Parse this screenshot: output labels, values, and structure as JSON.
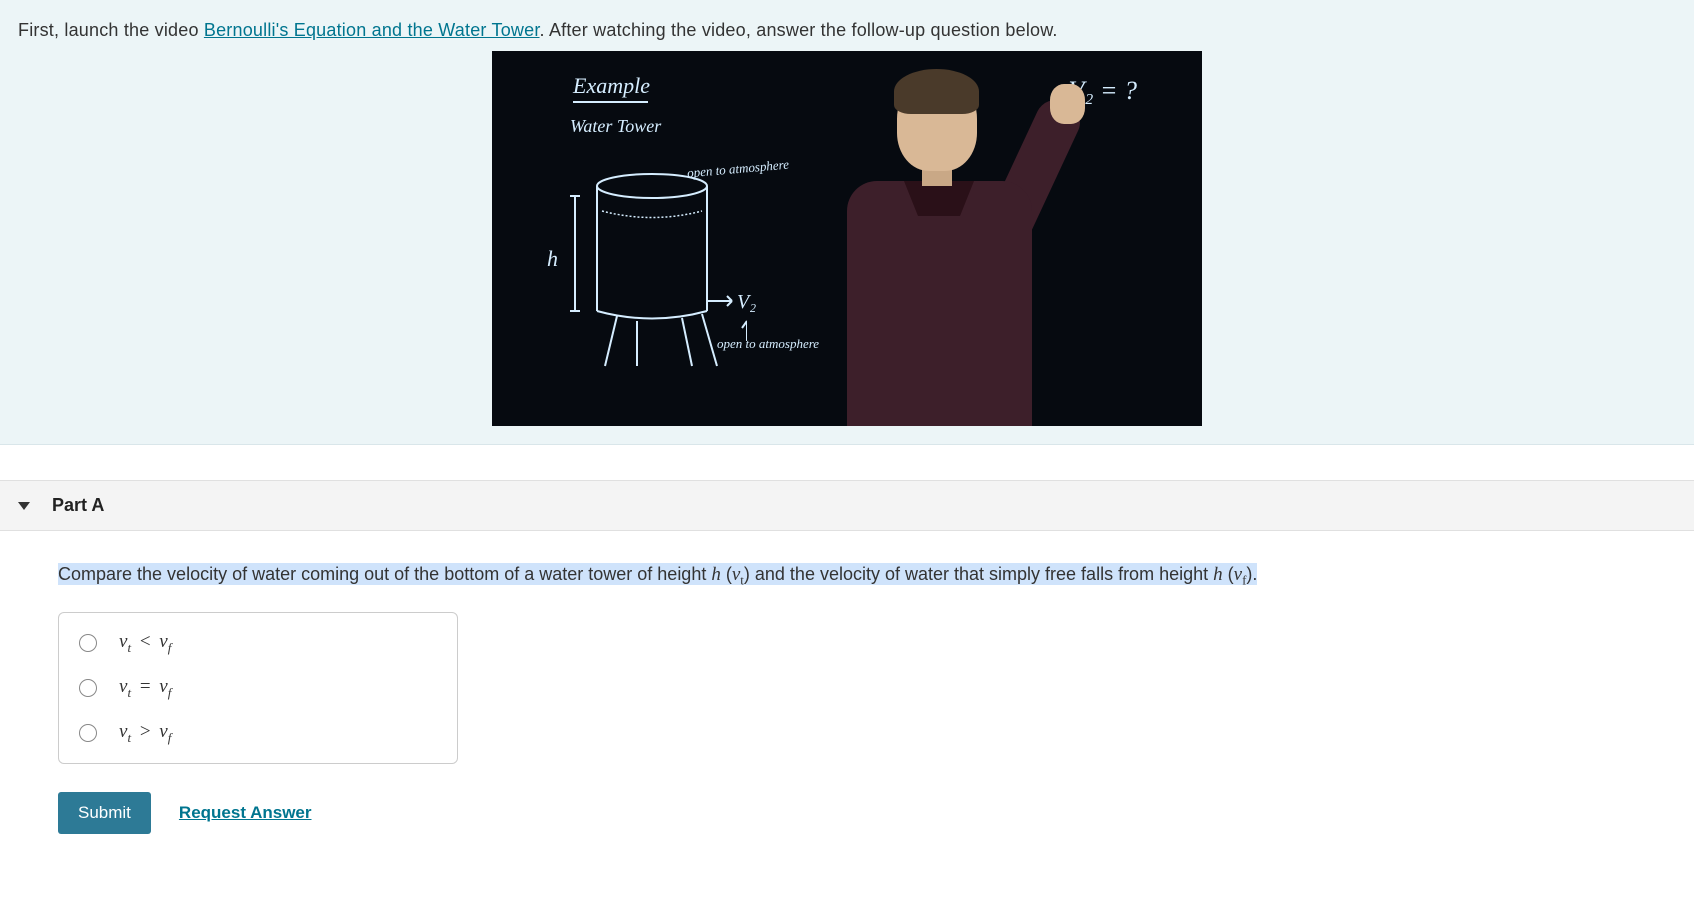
{
  "intro": {
    "prefix": "First, launch the video ",
    "link_text": "Bernoulli's Equation and the Water Tower",
    "suffix": ". After watching the video, answer the follow-up question below."
  },
  "video_board": {
    "title": "Example",
    "subtitle": "Water Tower",
    "open_top": "open to atmosphere",
    "open_bottom": "open to atmosphere",
    "h_label": "h",
    "v2_label": "V₂",
    "v2_question": "V₂ = ?"
  },
  "part": {
    "label": "Part A"
  },
  "question": {
    "seg1": "Compare the velocity of water coming out of the bottom of a water tower of height ",
    "h1": "h",
    "seg2": " (",
    "vt_var": "v",
    "vt_sub": "t",
    "seg3": ") and the velocity of water that simply free falls from height ",
    "h2": "h",
    "seg4": " (",
    "vf_var": "v",
    "vf_sub": "f",
    "seg5": ")."
  },
  "options": [
    {
      "lhs_v": "v",
      "lhs_s": "t",
      "op": "<",
      "rhs_v": "v",
      "rhs_s": "f"
    },
    {
      "lhs_v": "v",
      "lhs_s": "t",
      "op": "=",
      "rhs_v": "v",
      "rhs_s": "f"
    },
    {
      "lhs_v": "v",
      "lhs_s": "t",
      "op": ">",
      "rhs_v": "v",
      "rhs_s": "f"
    }
  ],
  "actions": {
    "submit": "Submit",
    "request": "Request Answer"
  }
}
